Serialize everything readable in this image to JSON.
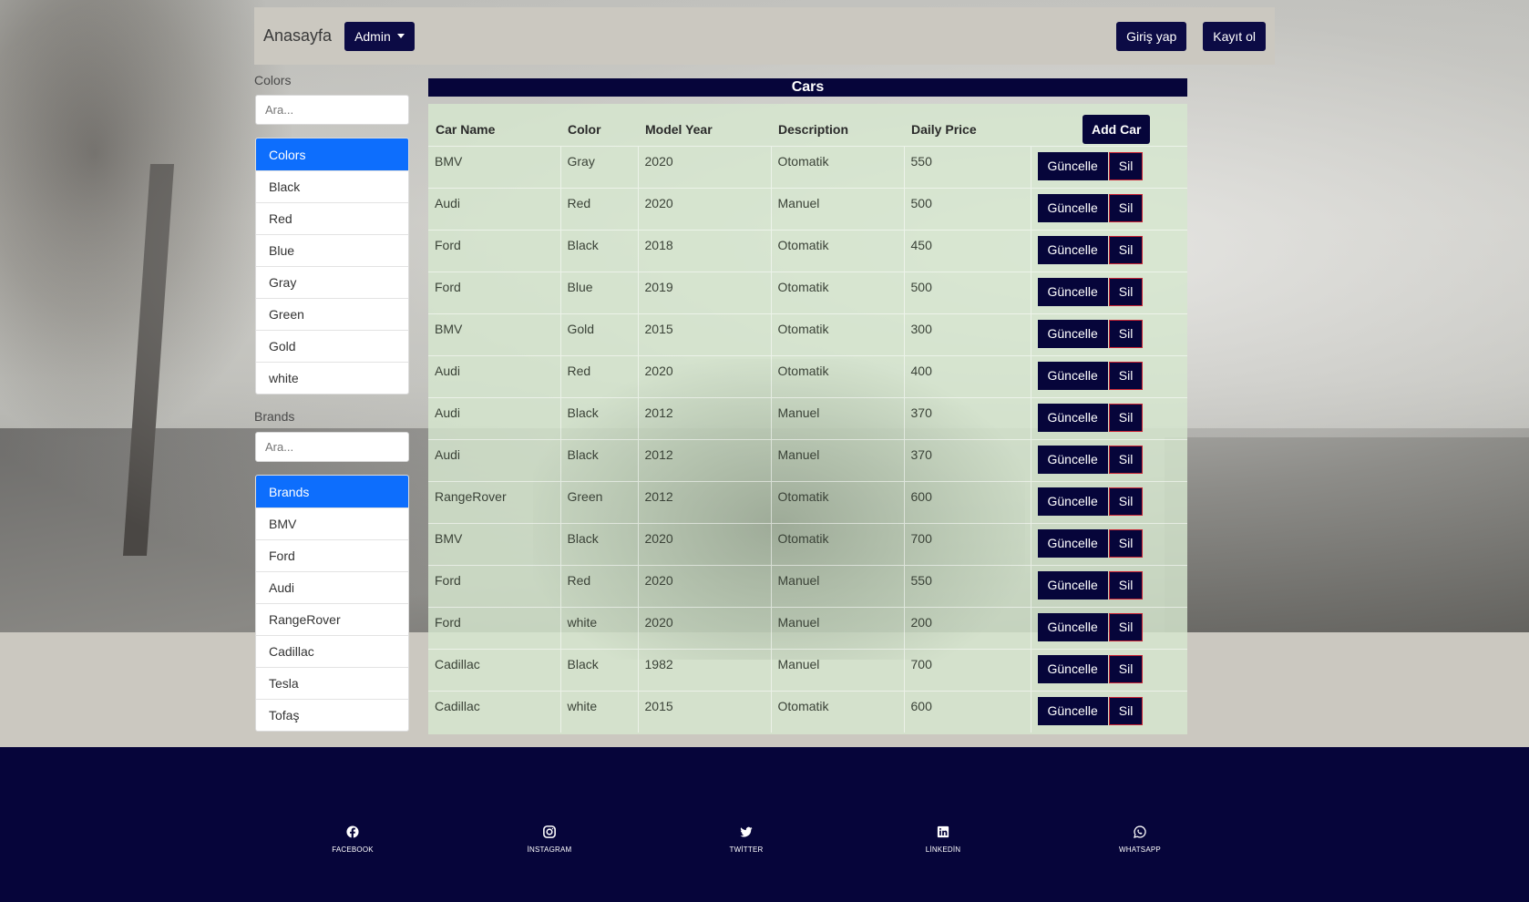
{
  "navbar": {
    "brand": "Anasayfa",
    "admin_label": "Admin",
    "login_label": "Giriş yap",
    "register_label": "Kayıt ol"
  },
  "colors": {
    "heading": "Colors",
    "search_placeholder": "Ara...",
    "items": [
      "Colors",
      "Black",
      "Red",
      "Blue",
      "Gray",
      "Green",
      "Gold",
      "white"
    ]
  },
  "brands": {
    "heading": "Brands",
    "search_placeholder": "Ara...",
    "items": [
      "Brands",
      "BMV",
      "Ford",
      "Audi",
      "RangeRover",
      "Cadillac",
      "Tesla",
      "Tofaş"
    ]
  },
  "table": {
    "title": "Cars",
    "columns": [
      "Car Name",
      "Color",
      "Model Year",
      "Description",
      "Daily Price"
    ],
    "add_label": "Add Car",
    "update_label": "Güncelle",
    "delete_label": "Sil",
    "rows": [
      [
        "BMV",
        "Gray",
        "2020",
        "Otomatik",
        "550"
      ],
      [
        "Audi",
        "Red",
        "2020",
        "Manuel",
        "500"
      ],
      [
        "Ford",
        "Black",
        "2018",
        "Otomatik",
        "450"
      ],
      [
        "Ford",
        "Blue",
        "2019",
        "Otomatik",
        "500"
      ],
      [
        "BMV",
        "Gold",
        "2015",
        "Otomatik",
        "300"
      ],
      [
        "Audi",
        "Red",
        "2020",
        "Otomatik",
        "400"
      ],
      [
        "Audi",
        "Black",
        "2012",
        "Manuel",
        "370"
      ],
      [
        "Audi",
        "Black",
        "2012",
        "Manuel",
        "370"
      ],
      [
        "RangeRover",
        "Green",
        "2012",
        "Otomatik",
        "600"
      ],
      [
        "BMV",
        "Black",
        "2020",
        "Otomatik",
        "700"
      ],
      [
        "Ford",
        "Red",
        "2020",
        "Manuel",
        "550"
      ],
      [
        "Ford",
        "white",
        "2020",
        "Manuel",
        "200"
      ],
      [
        "Cadillac",
        "Black",
        "1982",
        "Manuel",
        "700"
      ],
      [
        "Cadillac",
        "white",
        "2015",
        "Otomatik",
        "600"
      ]
    ]
  },
  "footer": {
    "social": [
      {
        "label": "FACEBOOK",
        "icon": "facebook-icon"
      },
      {
        "label": "İNSTAGRAM",
        "icon": "instagram-icon"
      },
      {
        "label": "TWİTTER",
        "icon": "twitter-icon"
      },
      {
        "label": "LİNKEDİN",
        "icon": "linkedin-icon"
      },
      {
        "label": "WHATSAPP",
        "icon": "whatsapp-icon"
      }
    ]
  },
  "theme": {
    "primary_dark": "#06053a",
    "active_blue": "#0d6efd",
    "delete_border": "#c82333"
  }
}
